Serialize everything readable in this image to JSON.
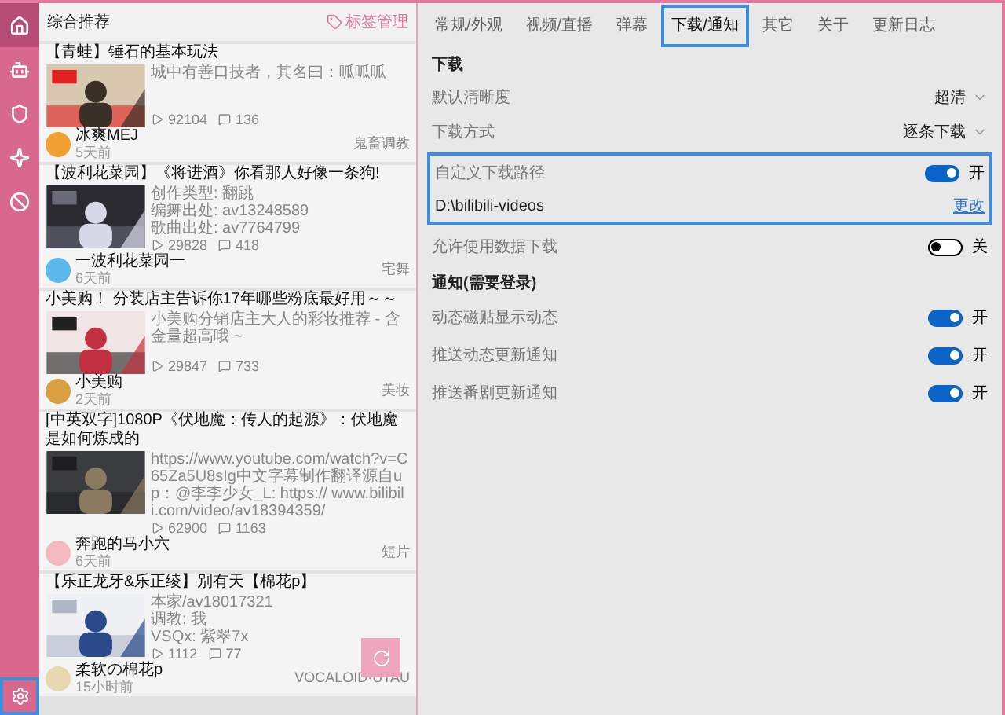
{
  "sidebar": {
    "items": [
      {
        "selected": true
      },
      {
        "selected": false
      },
      {
        "selected": false
      },
      {
        "selected": false
      },
      {
        "selected": false
      }
    ],
    "settings_focused": true
  },
  "feed": {
    "title": "综合推荐",
    "tag_manage": "标签管理",
    "cards": [
      {
        "title": "【青蛙】锤石的基本玩法",
        "description": [
          "城中有善口技者，其名曰：呱呱呱"
        ],
        "views": "92104",
        "danmaku": "136",
        "author": "冰爽MEJ",
        "time": "5天前",
        "category": "鬼畜调教"
      },
      {
        "title": "【波利花菜园】《将进酒》你看那人好像一条狗!",
        "description": [
          "创作类型: 翻跳",
          "编舞出处: av13248589",
          "歌曲出处: av7764799"
        ],
        "views": "29828",
        "danmaku": "418",
        "author": "一波利花菜园一",
        "time": "6天前",
        "category": "宅舞"
      },
      {
        "title": "小美购！ 分装店主告诉你17年哪些粉底最好用～～",
        "description": [
          "小美购分销店主大人的彩妆推荐 - 含金量超高哦 ~"
        ],
        "views": "29847",
        "danmaku": "733",
        "author": "小美购",
        "time": "2天前",
        "category": "美妆"
      },
      {
        "title": "[中英双字]1080P《伏地魔：传人的起源》：伏地魔是如何炼成的",
        "description": [
          "https://www.youtube.com/watch?v=C65Za5U8sIg中文字幕制作翻译源自up：@李李少女_L: https:// www.bilibili.com/video/av18394359/"
        ],
        "views": "62900",
        "danmaku": "1163",
        "author": "奔跑的马小六",
        "time": "6天前",
        "category": "短片"
      },
      {
        "title": "【乐正龙牙&乐正绫】别有天【棉花p】",
        "description": [
          "本家/av18017321",
          "调教: 我",
          "VSQx: 紫翠7x"
        ],
        "views": "1112",
        "danmaku": "77",
        "author": "柔软の棉花p",
        "time": "15小时前",
        "category": "VOCALOID·UTAU"
      }
    ]
  },
  "tabs": [
    {
      "label": "常规/外观",
      "selected": false
    },
    {
      "label": "视频/直播",
      "selected": false
    },
    {
      "label": "弹幕",
      "selected": false
    },
    {
      "label": "下载/通知",
      "selected": true
    },
    {
      "label": "其它",
      "selected": false
    },
    {
      "label": "关于",
      "selected": false
    },
    {
      "label": "更新日志",
      "selected": false
    }
  ],
  "sections": [
    {
      "title": "下载",
      "rows": [
        {
          "kind": "select",
          "label": "默认清晰度",
          "value": "超清"
        },
        {
          "kind": "select",
          "label": "下载方式",
          "value": "逐条下载"
        },
        {
          "kind": "path_group",
          "label": "自定义下载路径",
          "on": true,
          "state_label": "开",
          "path": "D:\\bilibili-videos",
          "link": "更改"
        },
        {
          "kind": "toggle",
          "label": "允许使用数据下载",
          "on": false,
          "state_label": "关"
        }
      ]
    },
    {
      "title": "通知(需要登录)",
      "rows": [
        {
          "kind": "toggle",
          "label": "动态磁贴显示动态",
          "on": true,
          "state_label": "开"
        },
        {
          "kind": "toggle",
          "label": "推送动态更新通知",
          "on": true,
          "state_label": "开"
        },
        {
          "kind": "toggle",
          "label": "推送番剧更新通知",
          "on": true,
          "state_label": "开"
        }
      ]
    }
  ]
}
